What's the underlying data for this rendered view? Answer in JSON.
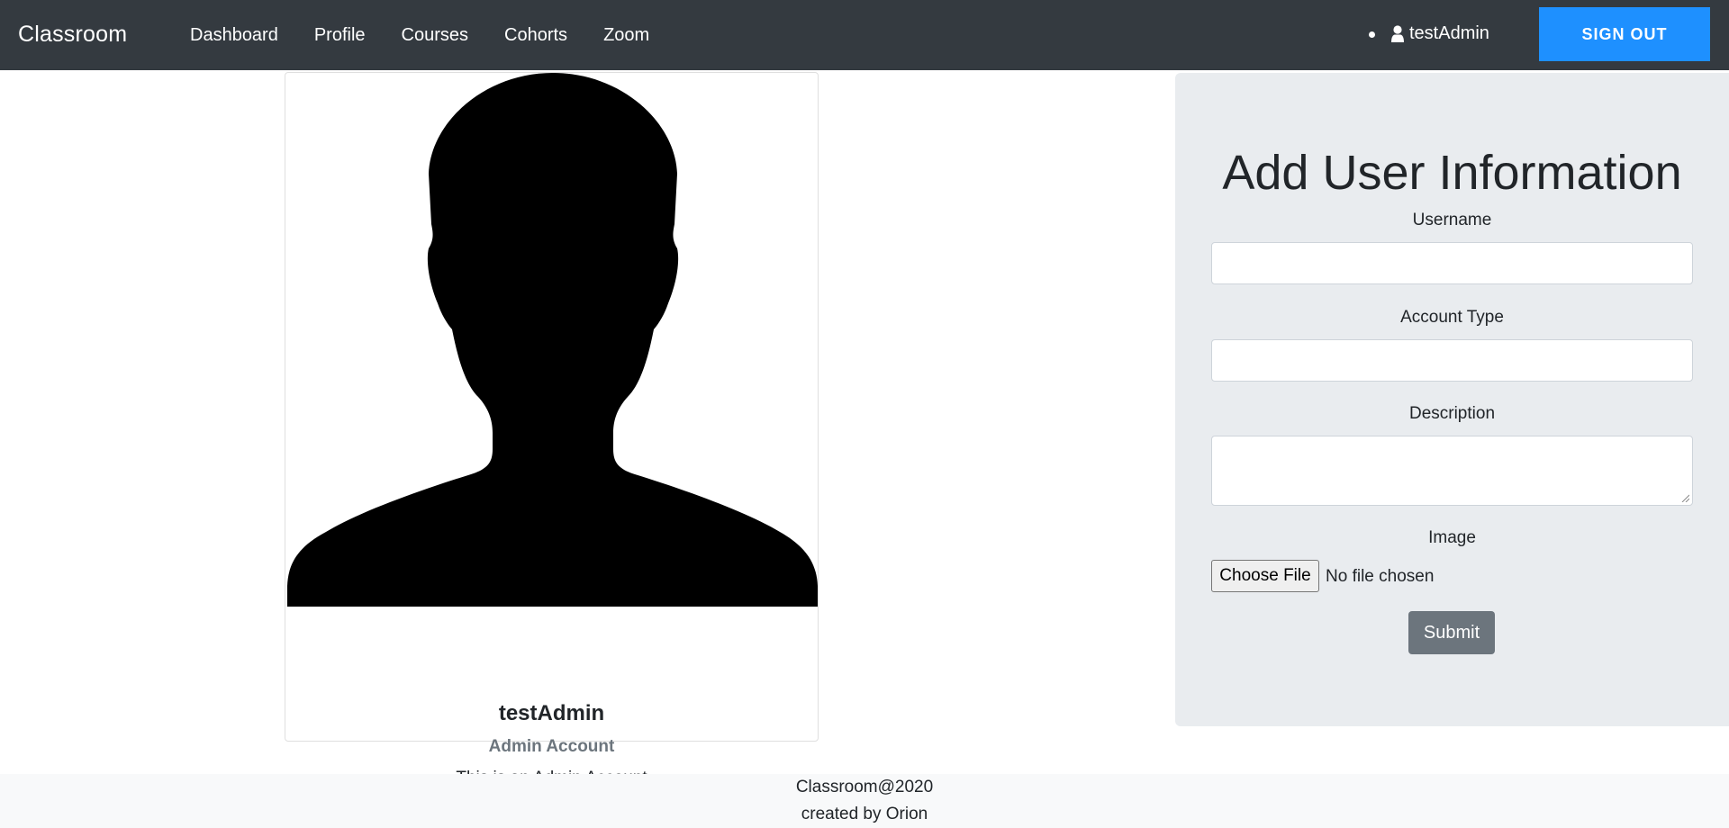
{
  "navbar": {
    "brand": "Classroom",
    "links": [
      "Dashboard",
      "Profile",
      "Courses",
      "Cohorts",
      "Zoom"
    ],
    "user_icon": "user-icon",
    "username": "testAdmin",
    "signout_label": "SIGN OUT",
    "colors": {
      "background": "#343a40",
      "signout": "#1e90ff"
    }
  },
  "profile": {
    "image_icon": "person-silhouette",
    "name": "testAdmin",
    "account_type": "Admin Account",
    "description": "This is an Admin Account"
  },
  "form": {
    "title": "Add User Information",
    "username_label": "Username",
    "username_value": "",
    "account_type_label": "Account Type",
    "account_type_value": "",
    "description_label": "Description",
    "description_value": "",
    "image_label": "Image",
    "file_button_label": "Choose File",
    "file_status": "No file chosen",
    "submit_label": "Submit",
    "colors": {
      "panel": "#e9ecef",
      "submit": "#6c757d"
    }
  },
  "footer": {
    "line1": "Classroom@2020",
    "line2": "created by Orion"
  }
}
